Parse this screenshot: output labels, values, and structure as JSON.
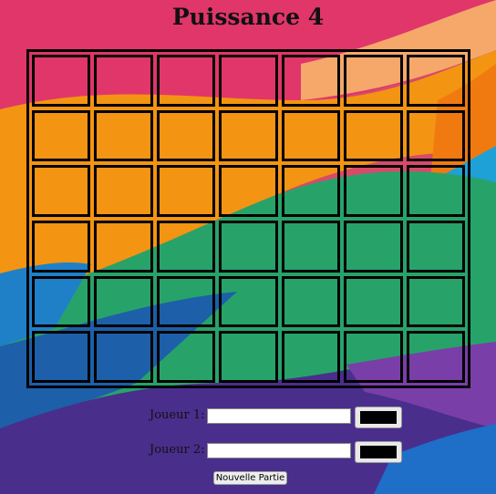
{
  "page": {
    "title": "Puissance 4"
  },
  "board": {
    "columns": 7,
    "rows": 6
  },
  "player1": {
    "label": "Joueur 1:",
    "name_value": "",
    "color": "#000000"
  },
  "player2": {
    "label": "Joueur 2:",
    "name_value": "",
    "color": "#000000"
  },
  "controls": {
    "new_game_label": "Nouvelle Partie"
  },
  "colors": {
    "grid_border": "#000000"
  }
}
